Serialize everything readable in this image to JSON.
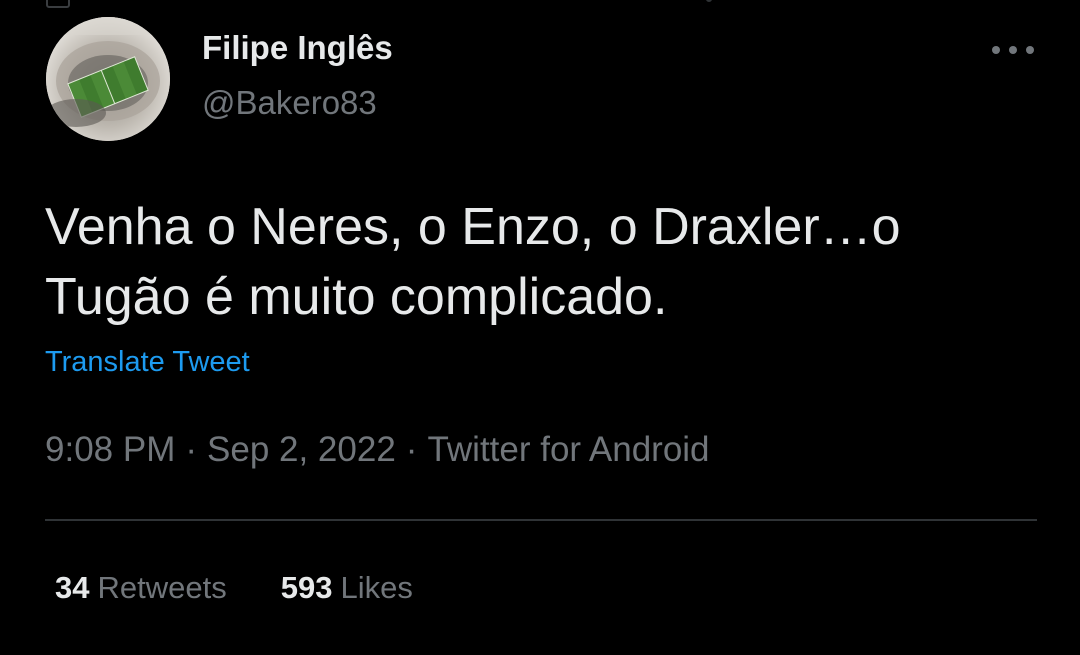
{
  "tweet": {
    "author": {
      "name": "Filipe Inglês",
      "handle": "@Bakero83"
    },
    "text_lines": [
      "Venha o Neres, o Enzo, o Draxler…o",
      "Tugão é muito complicado."
    ],
    "translate_label": "Translate Tweet",
    "time": "9:08 PM",
    "date": "Sep 2, 2022",
    "source": "Twitter for Android",
    "separator": "·",
    "stats": {
      "retweets_count": "34",
      "retweets_label": "Retweets",
      "likes_count": "593",
      "likes_label": "Likes"
    }
  },
  "icons": {
    "more": "more-horizontal-icon"
  },
  "colors": {
    "background": "#000000",
    "primary_text": "#e7e9ea",
    "secondary_text": "#71767b",
    "link": "#1d9bf0",
    "divider": "#2f3336"
  }
}
